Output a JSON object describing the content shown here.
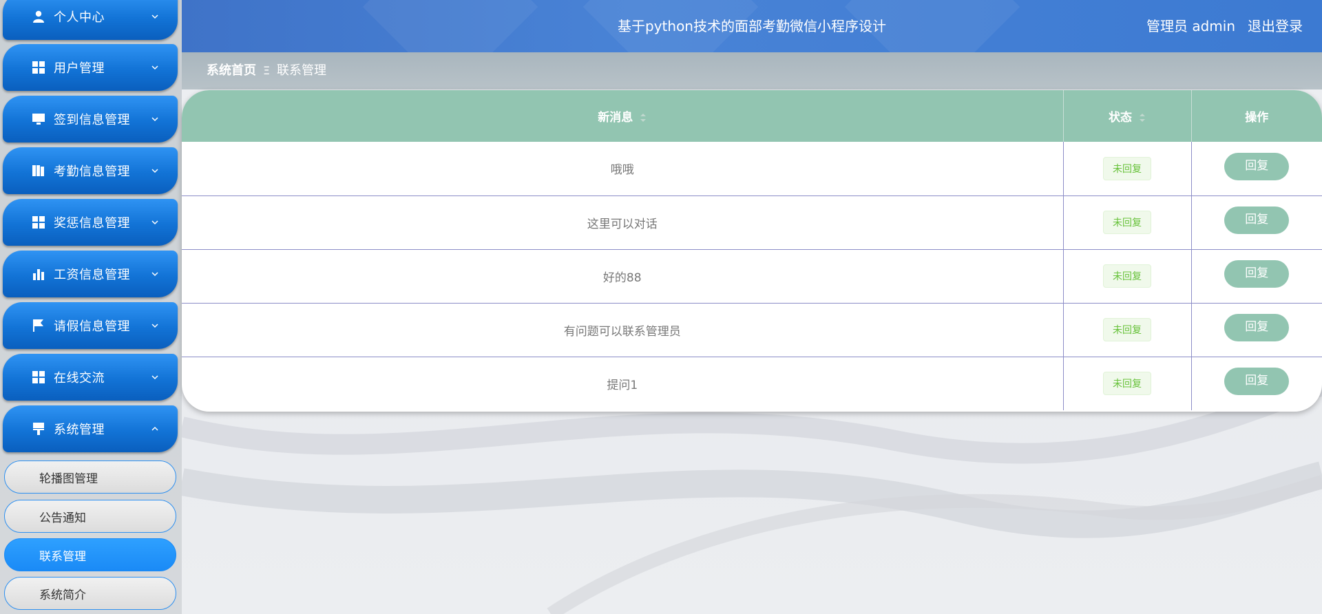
{
  "header": {
    "title": "基于python技术的面部考勤微信小程序设计",
    "user": "管理员 admin",
    "logout": "退出登录"
  },
  "breadcrumb": {
    "home": "系统首页",
    "separator": "Ξ",
    "current": "联系管理"
  },
  "sidebar": {
    "items": [
      {
        "label": "个人中心",
        "icon": "user-icon",
        "expanded": false
      },
      {
        "label": "用户管理",
        "icon": "grid-icon",
        "expanded": false
      },
      {
        "label": "签到信息管理",
        "icon": "monitor-icon",
        "expanded": false
      },
      {
        "label": "考勤信息管理",
        "icon": "book-icon",
        "expanded": false
      },
      {
        "label": "奖惩信息管理",
        "icon": "grid-icon",
        "expanded": false
      },
      {
        "label": "工资信息管理",
        "icon": "bar-chart-icon",
        "expanded": false
      },
      {
        "label": "请假信息管理",
        "icon": "flag-icon",
        "expanded": false
      },
      {
        "label": "在线交流",
        "icon": "grid-icon",
        "expanded": false
      },
      {
        "label": "系统管理",
        "icon": "brush-icon",
        "expanded": true
      }
    ],
    "subitems": [
      {
        "label": "轮播图管理",
        "active": false
      },
      {
        "label": "公告通知",
        "active": false
      },
      {
        "label": "联系管理",
        "active": true
      },
      {
        "label": "系统简介",
        "active": false
      }
    ]
  },
  "table": {
    "columns": [
      "新消息",
      "状态",
      "操作"
    ],
    "rows": [
      {
        "message": "哦哦",
        "status": "未回复",
        "action": "回复"
      },
      {
        "message": "这里可以对话",
        "status": "未回复",
        "action": "回复"
      },
      {
        "message": "好的88",
        "status": "未回复",
        "action": "回复"
      },
      {
        "message": "有问题可以联系管理员",
        "status": "未回复",
        "action": "回复"
      },
      {
        "message": "提问1",
        "status": "未回复",
        "action": "回复"
      }
    ]
  },
  "colors": {
    "header_blue": "#4580d4",
    "menu_blue": "#1273d6",
    "table_header_green": "#92c5b1",
    "status_green": "#67c23a"
  }
}
